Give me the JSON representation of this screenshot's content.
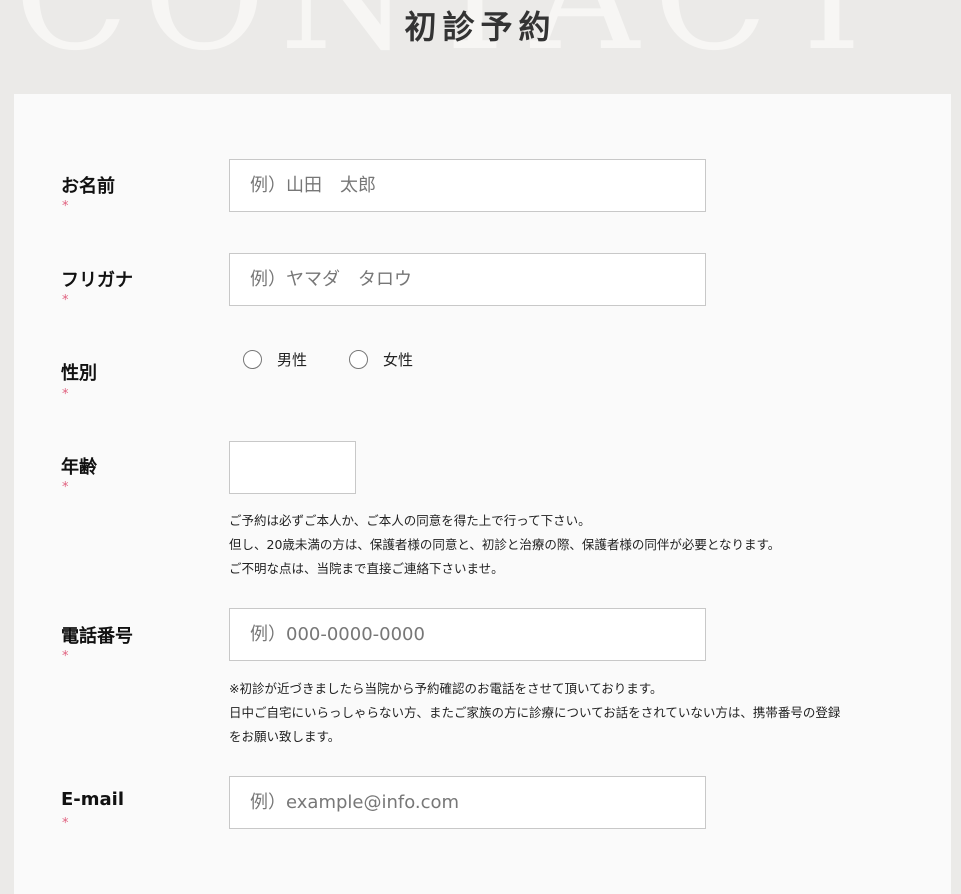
{
  "header": {
    "background_word": "CONTACT",
    "title": "初診予約"
  },
  "form": {
    "name": {
      "label": "お名前",
      "required_mark": "*",
      "placeholder": "例）山田　太郎",
      "value": ""
    },
    "furigana": {
      "label": "フリガナ",
      "required_mark": "*",
      "placeholder": "例）ヤマダ　タロウ",
      "value": ""
    },
    "gender": {
      "label": "性別",
      "required_mark": "*",
      "options": [
        {
          "label": "男性",
          "selected": false
        },
        {
          "label": "女性",
          "selected": false
        }
      ]
    },
    "age": {
      "label": "年齢",
      "required_mark": "*",
      "value": "",
      "notes": [
        "ご予約は必ずご本人か、ご本人の同意を得た上で行って下さい。",
        "但し、20歳未満の方は、保護者様の同意と、初診と治療の際、保護者様の同伴が必要となります。",
        "ご不明な点は、当院まで直接ご連絡下さいませ。"
      ]
    },
    "phone": {
      "label": "電話番号",
      "required_mark": "*",
      "placeholder": "例）000-0000-0000",
      "value": "",
      "notes": [
        "※初診が近づきましたら当院から予約確認のお電話をさせて頂いております。",
        "日中ご自宅にいらっしゃらない方、またご家族の方に診療についてお話をされていない方は、携帯番号の登録",
        "をお願い致します。"
      ]
    },
    "email": {
      "label": "E-mail",
      "required_mark": "*",
      "placeholder": "例）example@info.com",
      "value": ""
    }
  },
  "colors": {
    "page_bg": "#ebeae8",
    "panel_bg": "#fafafa",
    "required": "#e0607e"
  }
}
